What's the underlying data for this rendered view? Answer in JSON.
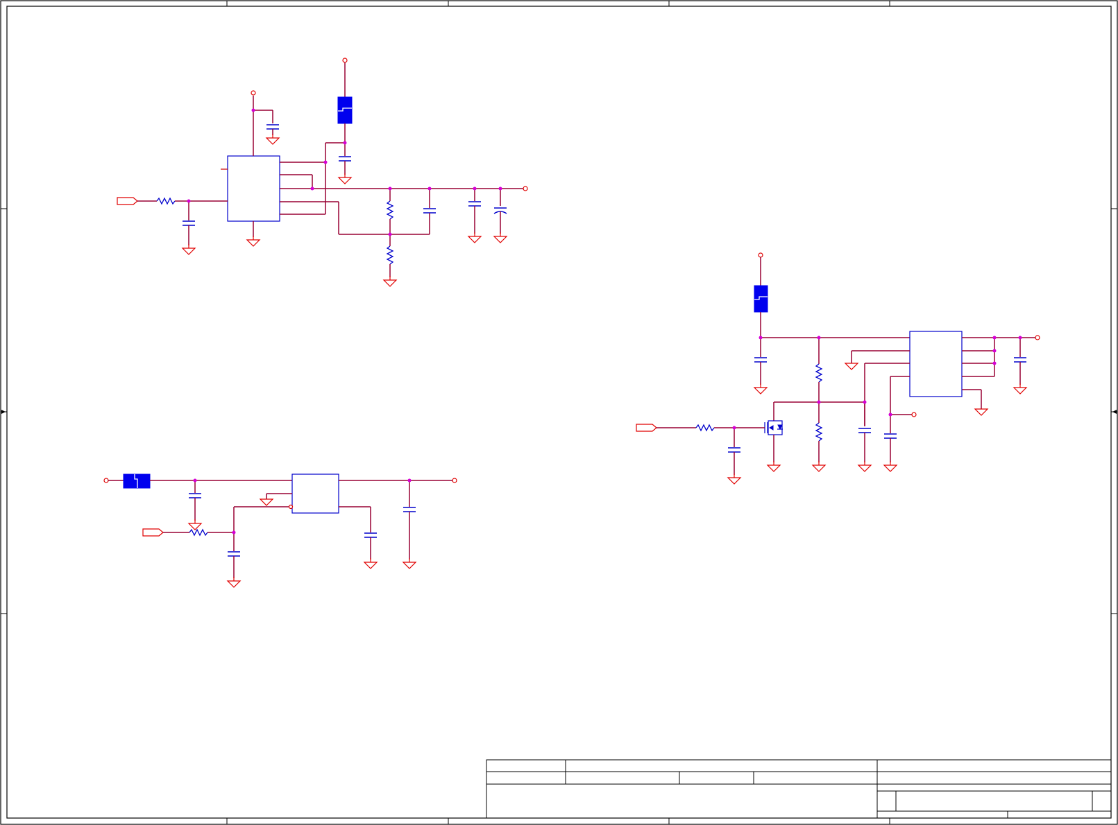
{
  "sheet": {
    "title_block_text": [],
    "zone_labels": []
  },
  "colors": {
    "wire": "#990033",
    "pin": "#cc0000",
    "ground": "#e00000",
    "junction": "#d600d6",
    "component": "#0000cc",
    "ferrite_bead": "#0000ee",
    "border": "#000000"
  },
  "icons": [
    "ground-symbol",
    "power-terminal",
    "input-port",
    "resistor",
    "capacitor",
    "ferrite-bead",
    "mosfet",
    "ic-block"
  ]
}
